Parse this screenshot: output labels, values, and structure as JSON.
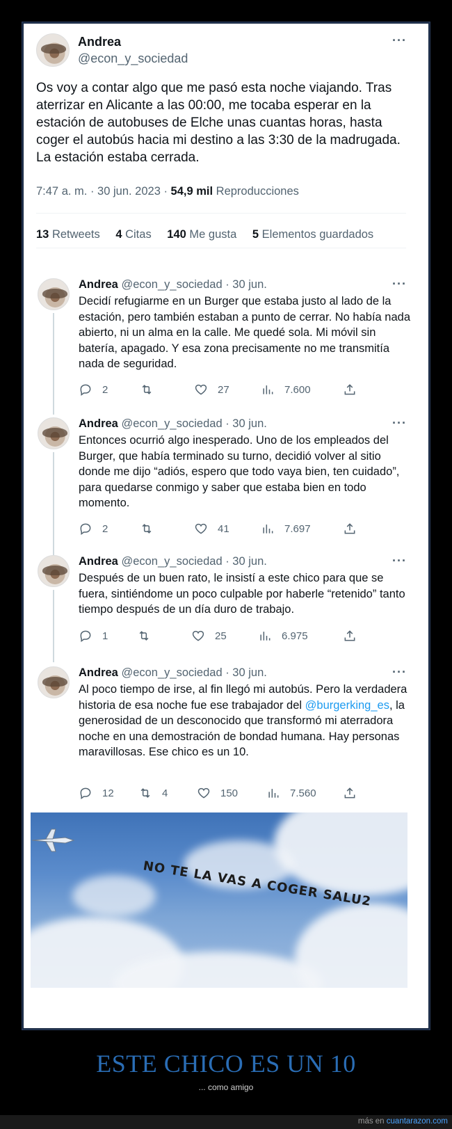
{
  "main_tweet": {
    "name": "Andrea",
    "handle": "@econ_y_sociedad",
    "more": "···",
    "text": "Os voy a contar algo que me pasó esta noche viajando. Tras aterrizar en Alicante a las 00:00, me tocaba esperar en la estación de autobuses de Elche unas cuantas horas, hasta coger el autobús hacia mi destino a las 3:30 de la madrugada. La estación estaba cerrada.",
    "time": "7:47 a. m. · 30 jun. 2023 · ",
    "views": "54,9 mil",
    "views_label": " Reproducciones",
    "stats": {
      "retweets": "13",
      "retweets_label": " Retweets",
      "quotes": "4",
      "quotes_label": " Citas",
      "likes": "140",
      "likes_label": " Me gusta",
      "bookmarks": "5",
      "bookmarks_label": " Elementos guardados"
    }
  },
  "replies": [
    {
      "name": "Andrea",
      "handle": "@econ_y_sociedad · 30 jun.",
      "text": "Decidí refugiarme en un Burger que estaba justo al lado de la estación, pero también estaban a punto de cerrar. No había nada abierto, ni un alma en la calle. Me quedé sola. Mi móvil sin batería, apagado. Y esa zona precisamente no me transmitía nada de seguridad.",
      "replies": "2",
      "retweets": "",
      "likes": "27",
      "views": "7.600"
    },
    {
      "name": "Andrea",
      "handle": "@econ_y_sociedad · 30 jun.",
      "text": "Entonces ocurrió algo inesperado. Uno de los empleados del Burger, que había terminado su turno, decidió volver al sitio donde me dijo “adiós, espero que todo vaya bien, ten cuidado”, para quedarse conmigo y saber que estaba bien en todo momento.",
      "replies": "2",
      "retweets": "",
      "likes": "41",
      "views": "7.697"
    },
    {
      "name": "Andrea",
      "handle": "@econ_y_sociedad · 30 jun.",
      "text": "Después de un buen rato, le insistí a este chico para que se fuera, sintiéndome un poco culpable por haberle “retenido” tanto tiempo después de un día duro de trabajo.",
      "replies": "1",
      "retweets": "",
      "likes": "25",
      "views": "6.975"
    },
    {
      "name": "Andrea",
      "handle": "@econ_y_sociedad · 30 jun.",
      "text_before": "Al poco tiempo de irse, al fin llegó mi autobús. Pero la verdadera historia de esa noche fue ese trabajador del ",
      "mention": "@burgerking_es",
      "text_after": ", la generosidad de un desconocido que transformó mi aterradora noche en una demostración de bondad humana. Hay personas maravillosas. Ese chico es un 10.",
      "replies": "12",
      "retweets": "4",
      "likes": "150",
      "views": "7.560"
    }
  ],
  "image": {
    "banner_text": "NO TE LA VAS A COGER SALU2"
  },
  "caption": {
    "title": "ESTE CHICO ES UN 10",
    "subtitle": "... como amigo"
  },
  "footer": {
    "prefix": "más en ",
    "site": "cuantarazon.com"
  },
  "colors": {
    "accent": "#2a6db5",
    "link": "#1d9bf0",
    "muted": "#536471"
  }
}
